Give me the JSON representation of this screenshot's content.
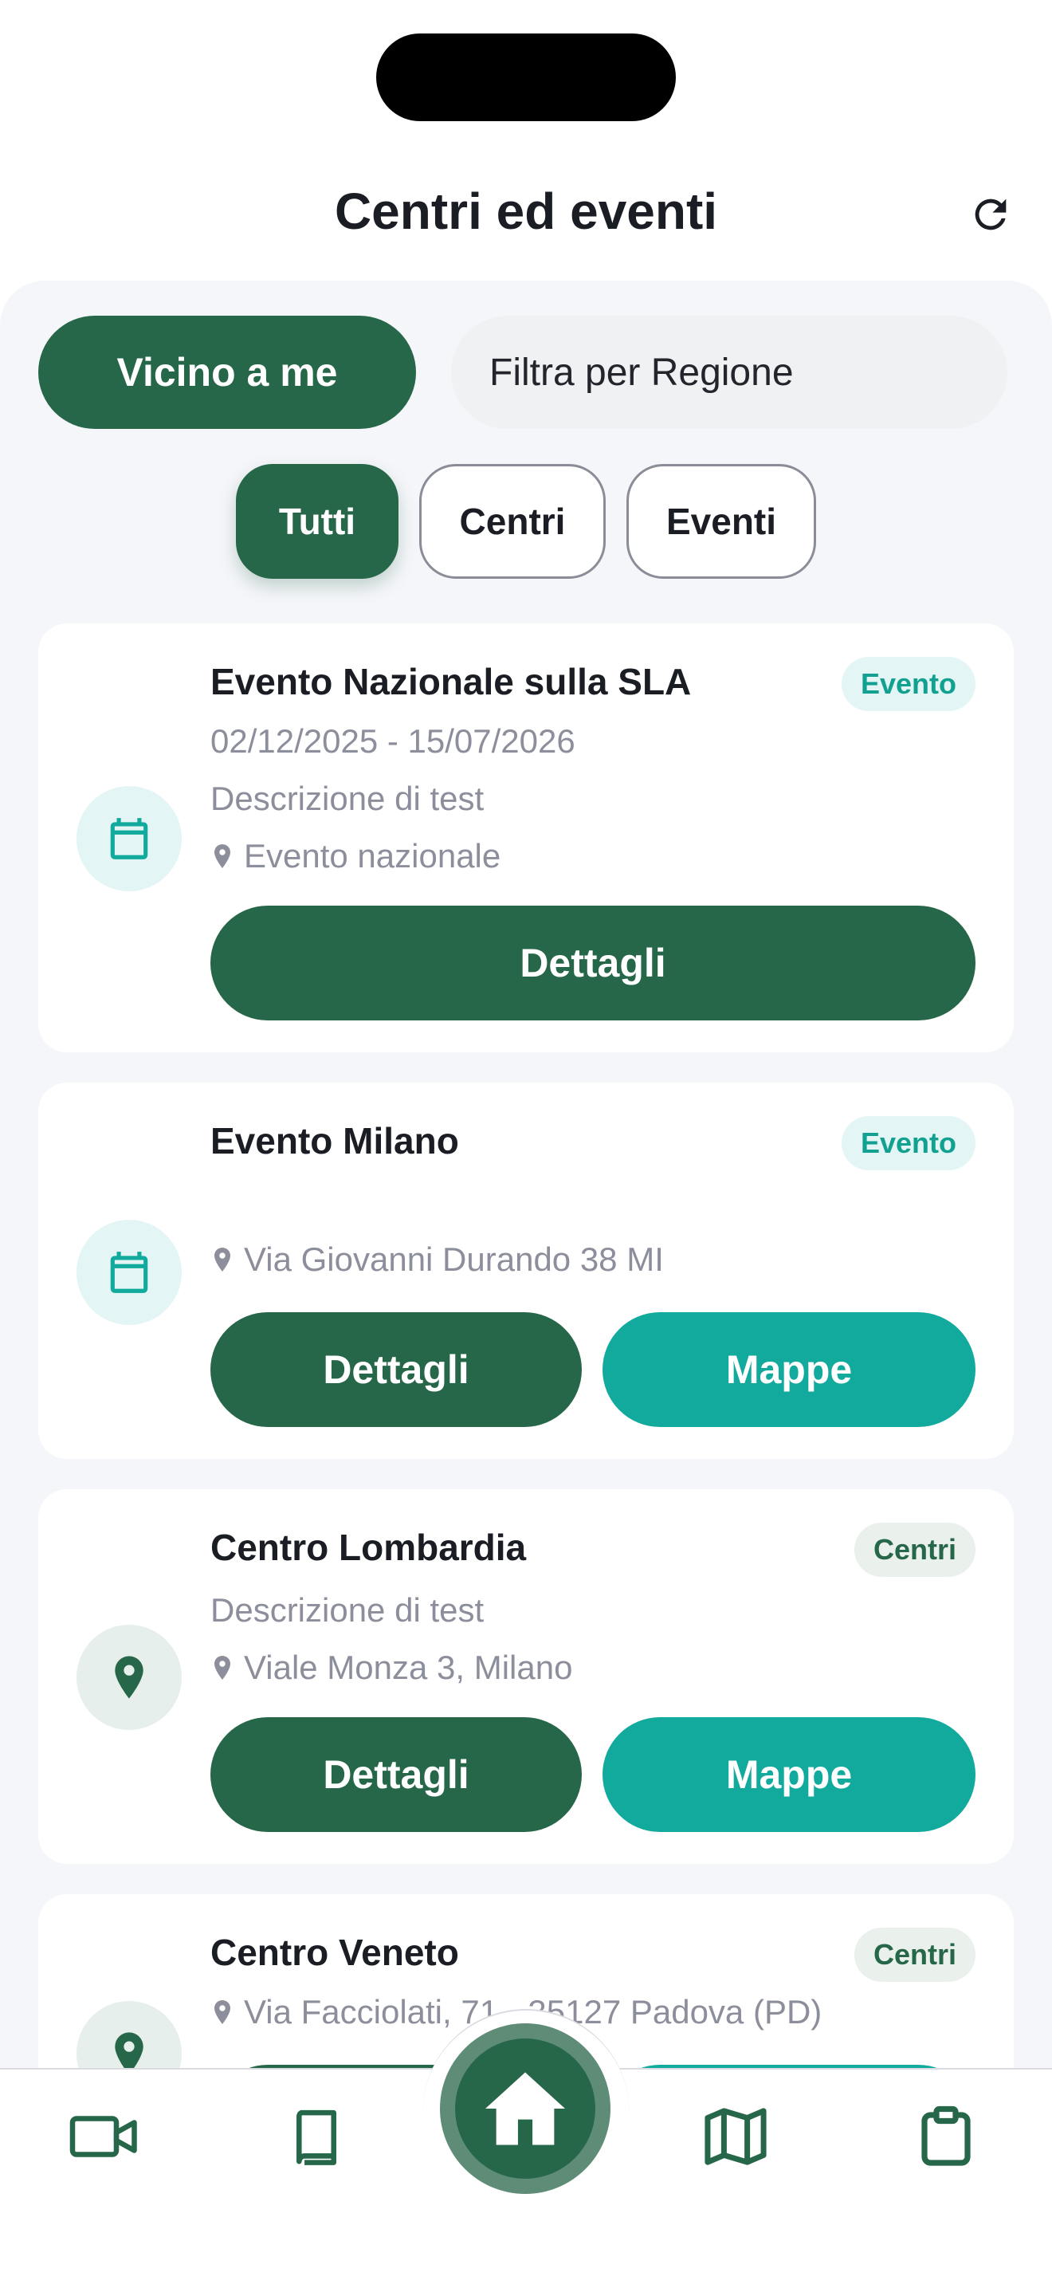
{
  "header": {
    "title": "Centri ed eventi"
  },
  "filters": {
    "near_label": "Vicino a me",
    "region_placeholder": "Filtra per Regione",
    "chips": [
      "Tutti",
      "Centri",
      "Eventi"
    ]
  },
  "cards": [
    {
      "type": "evento",
      "icon": "calendar-icon",
      "title": "Evento Nazionale sulla SLA",
      "badge": "Evento",
      "dates": "02/12/2025 - 15/07/2026",
      "description": "Descrizione di test",
      "location": "Evento nazionale",
      "details_label": "Dettagli"
    },
    {
      "type": "evento",
      "icon": "calendar-icon",
      "title": "Evento Milano",
      "badge": "Evento",
      "location": "Via Giovanni Durando 38 MI",
      "details_label": "Dettagli",
      "maps_label": "Mappe"
    },
    {
      "type": "centro",
      "icon": "map-pin-icon",
      "title": "Centro Lombardia",
      "badge": "Centri",
      "description": "Descrizione di test",
      "location": "Viale Monza 3, Milano",
      "details_label": "Dettagli",
      "maps_label": "Mappe"
    },
    {
      "type": "centro",
      "icon": "map-pin-icon",
      "title": "Centro Veneto",
      "badge": "Centri",
      "location": "Via Facciolati, 71 - 35127 Padova (PD)"
    }
  ],
  "nav": {
    "items": [
      "video-camera-icon",
      "book-icon",
      "home-icon",
      "map-icon",
      "clipboard-icon"
    ],
    "active": "home-icon"
  },
  "colors": {
    "primary": "#276749",
    "accent": "#13aa9e",
    "background": "#f5f6fa"
  }
}
